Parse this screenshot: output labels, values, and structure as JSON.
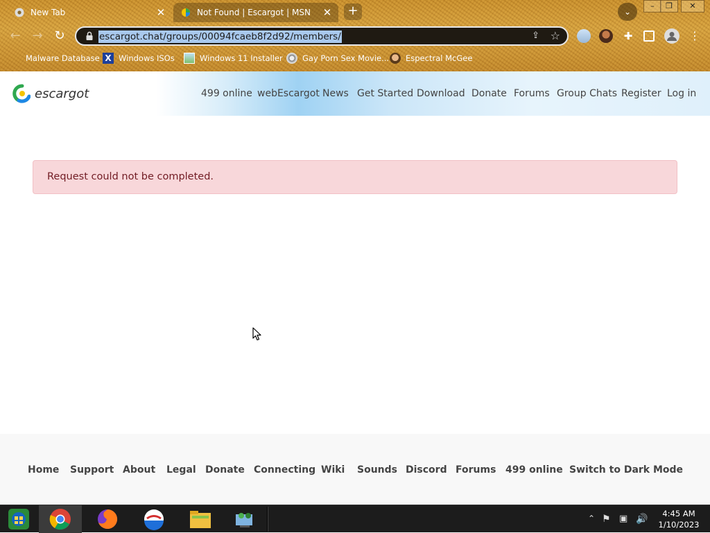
{
  "browser": {
    "tabs": [
      {
        "title": "New Tab",
        "active": false
      },
      {
        "title": "Not Found | Escargot | MSN Me",
        "active": true
      }
    ],
    "new_tab_label": "+",
    "url": "escargot.chat/groups/00094fcaeb8f2d92/members/",
    "bookmarks": [
      {
        "label": "Malware Database",
        "icon": "blank-icon"
      },
      {
        "label": "Windows ISOs",
        "icon": "x-icon"
      },
      {
        "label": "Windows 11 Installer",
        "icon": "image-icon"
      },
      {
        "label": "Gay Porn Sex Movie...",
        "icon": "film-icon"
      },
      {
        "label": "Espectral McGee",
        "icon": "face-icon"
      }
    ]
  },
  "site": {
    "brand": "escargot",
    "nav": [
      "499 online",
      "webEscargot",
      "News",
      "Get Started",
      "Download",
      "Donate",
      "Forums",
      "Group Chats",
      "Register",
      "Log in"
    ],
    "alert": "Request could not be completed.",
    "footer": [
      "Home",
      "Support",
      "About",
      "Legal",
      "Donate",
      "Connecting",
      "Wiki",
      "Sounds",
      "Discord",
      "Forums",
      "499 online",
      "Switch to Dark Mode"
    ],
    "colors": {
      "alert_bg": "#f8d7da",
      "alert_text": "#721c24",
      "footer_bg": "#f8f8f8"
    }
  },
  "taskbar": {
    "apps": [
      "start-orb",
      "chrome",
      "firefox",
      "msn-messenger",
      "file-explorer",
      "network-users"
    ],
    "clock": {
      "time": "4:45 AM",
      "date": "1/10/2023"
    }
  }
}
